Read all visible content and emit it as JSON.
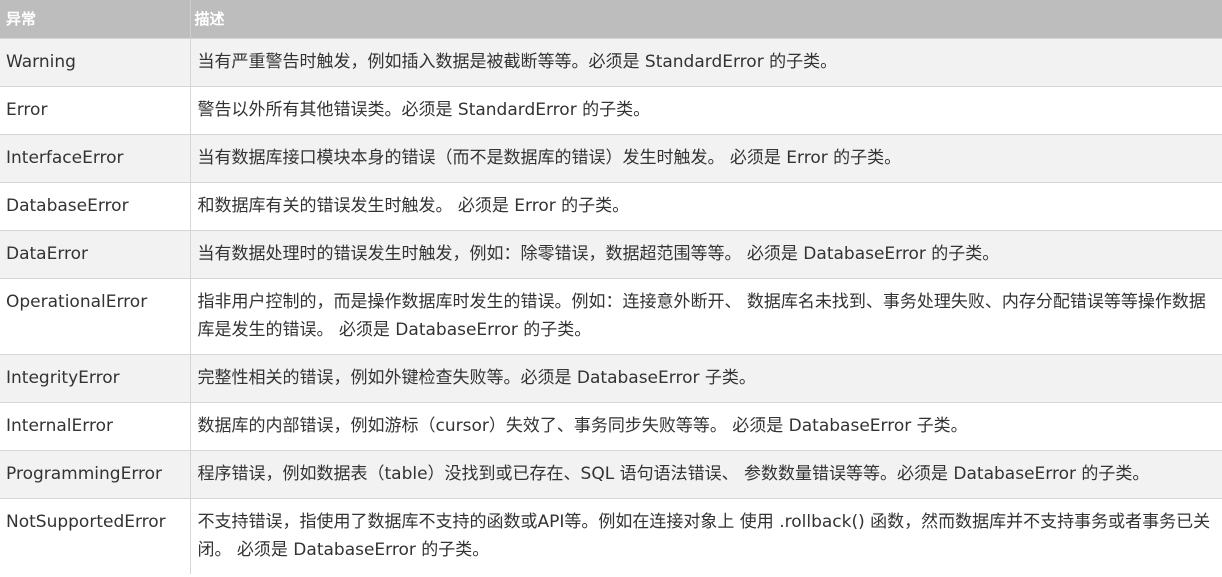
{
  "header": {
    "col1": "异常",
    "col2": "描述"
  },
  "rows": [
    {
      "name": "Warning",
      "desc": "当有严重警告时触发，例如插入数据是被截断等等。必须是 StandardError 的子类。"
    },
    {
      "name": "Error",
      "desc": "警告以外所有其他错误类。必须是 StandardError 的子类。"
    },
    {
      "name": "InterfaceError",
      "desc": "当有数据库接口模块本身的错误（而不是数据库的错误）发生时触发。 必须是 Error 的子类。"
    },
    {
      "name": "DatabaseError",
      "desc": "和数据库有关的错误发生时触发。 必须是 Error 的子类。"
    },
    {
      "name": "DataError",
      "desc": "当有数据处理时的错误发生时触发，例如：除零错误，数据超范围等等。 必须是 DatabaseError 的子类。"
    },
    {
      "name": "OperationalError",
      "desc": "指非用户控制的，而是操作数据库时发生的错误。例如：连接意外断开、 数据库名未找到、事务处理失败、内存分配错误等等操作数据库是发生的错误。 必须是 DatabaseError 的子类。"
    },
    {
      "name": "IntegrityError",
      "desc": "完整性相关的错误，例如外键检查失败等。必须是 DatabaseError 子类。"
    },
    {
      "name": "InternalError",
      "desc": "数据库的内部错误，例如游标（cursor）失效了、事务同步失败等等。 必须是 DatabaseError 子类。"
    },
    {
      "name": "ProgrammingError",
      "desc": "程序错误，例如数据表（table）没找到或已存在、SQL 语句语法错误、 参数数量错误等等。必须是 DatabaseError 的子类。"
    },
    {
      "name": "NotSupportedError",
      "desc": "不支持错误，指使用了数据库不支持的函数或API等。例如在连接对象上 使用 .rollback() 函数，然而数据库并不支持事务或者事务已关闭。 必须是 DatabaseError 的子类。"
    }
  ]
}
